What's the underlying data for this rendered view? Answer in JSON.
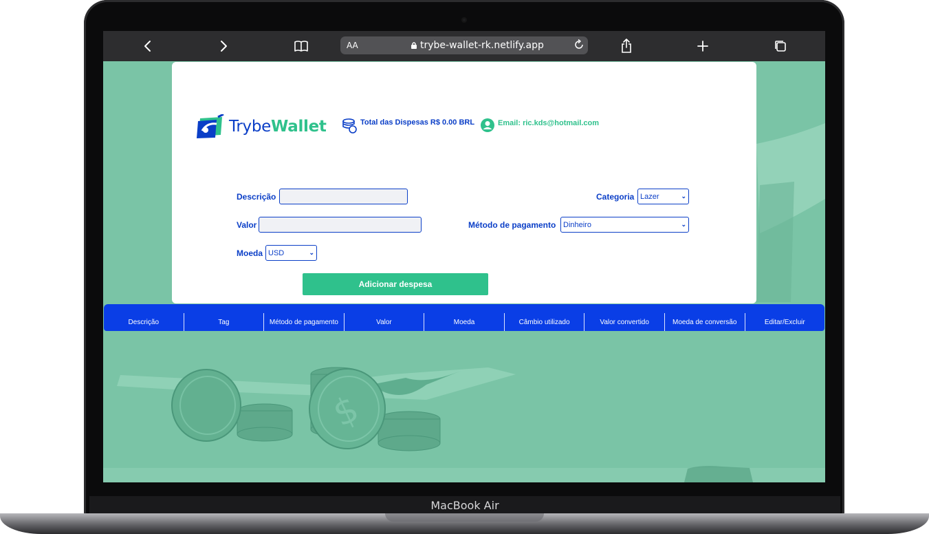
{
  "device": {
    "model_label": "MacBook Air"
  },
  "browser": {
    "text_size_label": "AA",
    "url": "trybe-wallet-rk.netlify.app",
    "icons": [
      "chevron-left-icon",
      "chevron-right-icon",
      "book-icon",
      "lock-icon",
      "reload-icon",
      "share-icon",
      "plus-icon",
      "tabs-icon"
    ]
  },
  "header": {
    "logo_prefix": "Trybe",
    "logo_bold": "Wallet",
    "total_label": "Total das Dispesas R$ 0.00 BRL",
    "email_label": "Email: ric.kds@hotmail.com"
  },
  "form": {
    "description_label": "Descrição",
    "description_value": "",
    "value_label": "Valor",
    "value_value": "",
    "currency_label": "Moeda",
    "currency_selected": "USD",
    "category_label": "Categoria",
    "category_selected": "Lazer",
    "payment_label": "Método de pagamento",
    "payment_selected": "Dinheiro",
    "submit_label": "Adicionar despesa"
  },
  "table": {
    "headers": [
      "Descrição",
      "Tag",
      "Método de pagamento",
      "Valor",
      "Moeda",
      "Câmbio utilizado",
      "Valor convertido",
      "Moeda de conversão",
      "Editar/Excluir"
    ]
  },
  "colors": {
    "brand_blue": "#0a3ec7",
    "brand_green": "#2fc18c",
    "background_green": "#7ac4a6",
    "table_header_blue": "#0a3ee6"
  }
}
